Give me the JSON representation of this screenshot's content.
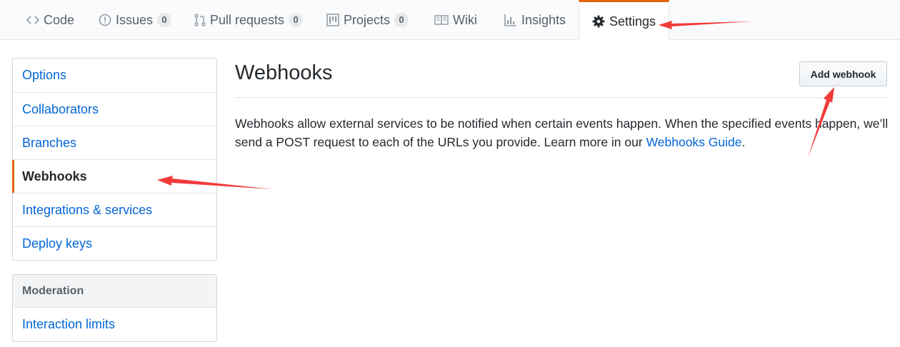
{
  "tabs": [
    {
      "label": "Code",
      "icon": "code-icon"
    },
    {
      "label": "Issues",
      "icon": "issue-icon",
      "count": "0"
    },
    {
      "label": "Pull requests",
      "icon": "git-pull-request-icon",
      "count": "0"
    },
    {
      "label": "Projects",
      "icon": "project-icon",
      "count": "0"
    },
    {
      "label": "Wiki",
      "icon": "book-icon"
    },
    {
      "label": "Insights",
      "icon": "graph-icon"
    },
    {
      "label": "Settings",
      "icon": "gear-icon",
      "selected": true
    }
  ],
  "sidebar": {
    "items": [
      {
        "label": "Options"
      },
      {
        "label": "Collaborators"
      },
      {
        "label": "Branches"
      },
      {
        "label": "Webhooks",
        "selected": true
      },
      {
        "label": "Integrations & services"
      },
      {
        "label": "Deploy keys"
      }
    ],
    "moderation": {
      "heading": "Moderation",
      "items": [
        {
          "label": "Interaction limits"
        }
      ]
    }
  },
  "main": {
    "title": "Webhooks",
    "add_button_label": "Add webhook",
    "description_text": "Webhooks allow external services to be notified when certain events happen. When the specified events happen, we’ll send a POST request to each of the URLs you provide. Learn more in our ",
    "guide_link_label": "Webhooks Guide",
    "description_end": "."
  },
  "colors": {
    "accent": "#e36209",
    "link": "#0366d6",
    "annotation": "#f23a3a"
  }
}
